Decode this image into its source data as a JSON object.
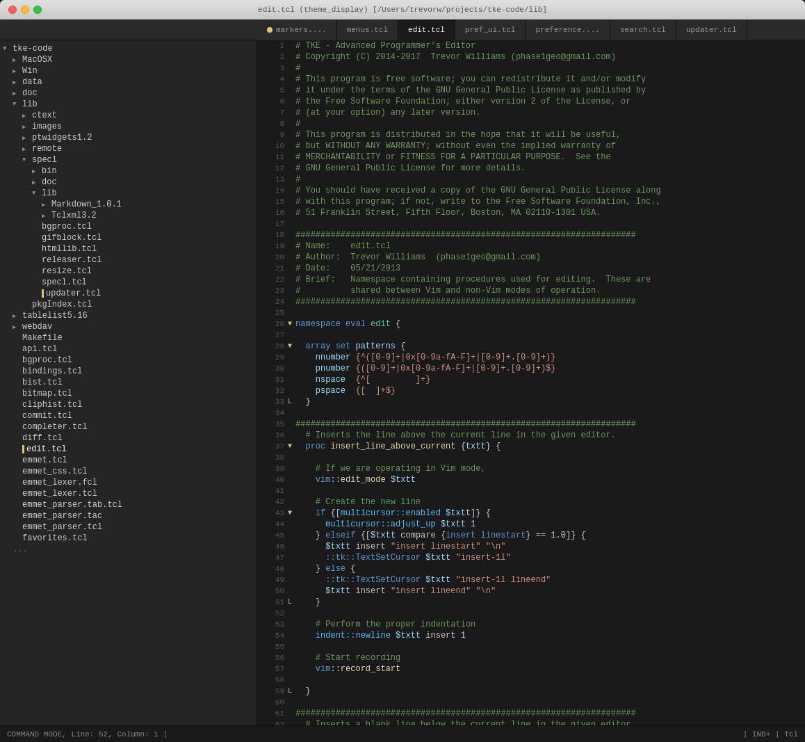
{
  "titlebar": {
    "title": "edit.tcl (theme_display) [/Users/trevorw/projects/tke-code/lib]"
  },
  "tabs": [
    {
      "label": "markers....",
      "active": false,
      "dot": false
    },
    {
      "label": "menus.tcl",
      "active": false,
      "dot": false
    },
    {
      "label": "edit.tcl",
      "active": true,
      "dot": false
    },
    {
      "label": "pref_ui.tcl",
      "active": false,
      "dot": false
    },
    {
      "label": "preference....",
      "active": false,
      "dot": false
    },
    {
      "label": "search.tcl",
      "active": false,
      "dot": false
    },
    {
      "label": "updater.tcl",
      "active": false,
      "dot": false
    }
  ],
  "sidebar": {
    "root": "tke-code"
  },
  "status": {
    "left": "COMMAND MODE, Line: 52, Column: 1  |",
    "right": "| IND+  |  Tcl"
  }
}
